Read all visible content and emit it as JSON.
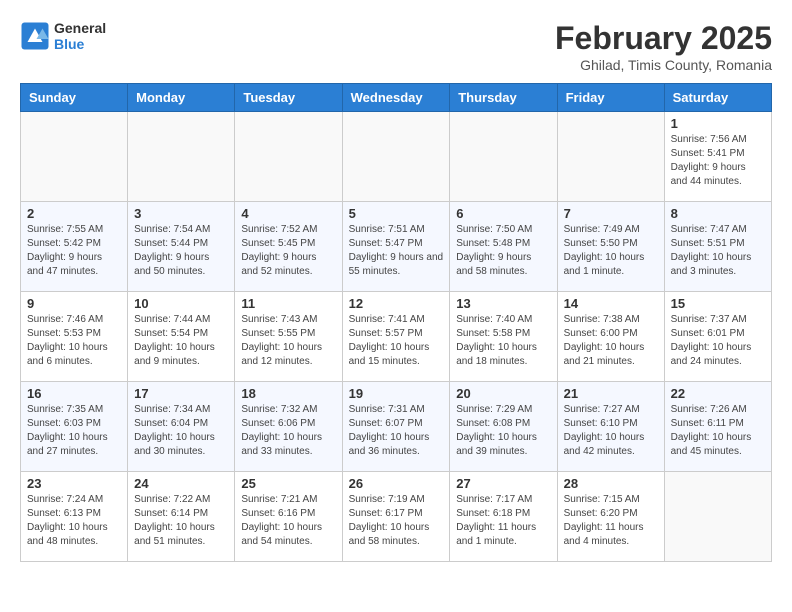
{
  "header": {
    "logo_general": "General",
    "logo_blue": "Blue",
    "month_title": "February 2025",
    "location": "Ghilad, Timis County, Romania"
  },
  "weekdays": [
    "Sunday",
    "Monday",
    "Tuesday",
    "Wednesday",
    "Thursday",
    "Friday",
    "Saturday"
  ],
  "weeks": [
    [
      {
        "day": "",
        "info": ""
      },
      {
        "day": "",
        "info": ""
      },
      {
        "day": "",
        "info": ""
      },
      {
        "day": "",
        "info": ""
      },
      {
        "day": "",
        "info": ""
      },
      {
        "day": "",
        "info": ""
      },
      {
        "day": "1",
        "info": "Sunrise: 7:56 AM\nSunset: 5:41 PM\nDaylight: 9 hours and 44 minutes."
      }
    ],
    [
      {
        "day": "2",
        "info": "Sunrise: 7:55 AM\nSunset: 5:42 PM\nDaylight: 9 hours and 47 minutes."
      },
      {
        "day": "3",
        "info": "Sunrise: 7:54 AM\nSunset: 5:44 PM\nDaylight: 9 hours and 50 minutes."
      },
      {
        "day": "4",
        "info": "Sunrise: 7:52 AM\nSunset: 5:45 PM\nDaylight: 9 hours and 52 minutes."
      },
      {
        "day": "5",
        "info": "Sunrise: 7:51 AM\nSunset: 5:47 PM\nDaylight: 9 hours and 55 minutes."
      },
      {
        "day": "6",
        "info": "Sunrise: 7:50 AM\nSunset: 5:48 PM\nDaylight: 9 hours and 58 minutes."
      },
      {
        "day": "7",
        "info": "Sunrise: 7:49 AM\nSunset: 5:50 PM\nDaylight: 10 hours and 1 minute."
      },
      {
        "day": "8",
        "info": "Sunrise: 7:47 AM\nSunset: 5:51 PM\nDaylight: 10 hours and 3 minutes."
      }
    ],
    [
      {
        "day": "9",
        "info": "Sunrise: 7:46 AM\nSunset: 5:53 PM\nDaylight: 10 hours and 6 minutes."
      },
      {
        "day": "10",
        "info": "Sunrise: 7:44 AM\nSunset: 5:54 PM\nDaylight: 10 hours and 9 minutes."
      },
      {
        "day": "11",
        "info": "Sunrise: 7:43 AM\nSunset: 5:55 PM\nDaylight: 10 hours and 12 minutes."
      },
      {
        "day": "12",
        "info": "Sunrise: 7:41 AM\nSunset: 5:57 PM\nDaylight: 10 hours and 15 minutes."
      },
      {
        "day": "13",
        "info": "Sunrise: 7:40 AM\nSunset: 5:58 PM\nDaylight: 10 hours and 18 minutes."
      },
      {
        "day": "14",
        "info": "Sunrise: 7:38 AM\nSunset: 6:00 PM\nDaylight: 10 hours and 21 minutes."
      },
      {
        "day": "15",
        "info": "Sunrise: 7:37 AM\nSunset: 6:01 PM\nDaylight: 10 hours and 24 minutes."
      }
    ],
    [
      {
        "day": "16",
        "info": "Sunrise: 7:35 AM\nSunset: 6:03 PM\nDaylight: 10 hours and 27 minutes."
      },
      {
        "day": "17",
        "info": "Sunrise: 7:34 AM\nSunset: 6:04 PM\nDaylight: 10 hours and 30 minutes."
      },
      {
        "day": "18",
        "info": "Sunrise: 7:32 AM\nSunset: 6:06 PM\nDaylight: 10 hours and 33 minutes."
      },
      {
        "day": "19",
        "info": "Sunrise: 7:31 AM\nSunset: 6:07 PM\nDaylight: 10 hours and 36 minutes."
      },
      {
        "day": "20",
        "info": "Sunrise: 7:29 AM\nSunset: 6:08 PM\nDaylight: 10 hours and 39 minutes."
      },
      {
        "day": "21",
        "info": "Sunrise: 7:27 AM\nSunset: 6:10 PM\nDaylight: 10 hours and 42 minutes."
      },
      {
        "day": "22",
        "info": "Sunrise: 7:26 AM\nSunset: 6:11 PM\nDaylight: 10 hours and 45 minutes."
      }
    ],
    [
      {
        "day": "23",
        "info": "Sunrise: 7:24 AM\nSunset: 6:13 PM\nDaylight: 10 hours and 48 minutes."
      },
      {
        "day": "24",
        "info": "Sunrise: 7:22 AM\nSunset: 6:14 PM\nDaylight: 10 hours and 51 minutes."
      },
      {
        "day": "25",
        "info": "Sunrise: 7:21 AM\nSunset: 6:16 PM\nDaylight: 10 hours and 54 minutes."
      },
      {
        "day": "26",
        "info": "Sunrise: 7:19 AM\nSunset: 6:17 PM\nDaylight: 10 hours and 58 minutes."
      },
      {
        "day": "27",
        "info": "Sunrise: 7:17 AM\nSunset: 6:18 PM\nDaylight: 11 hours and 1 minute."
      },
      {
        "day": "28",
        "info": "Sunrise: 7:15 AM\nSunset: 6:20 PM\nDaylight: 11 hours and 4 minutes."
      },
      {
        "day": "",
        "info": ""
      }
    ]
  ]
}
